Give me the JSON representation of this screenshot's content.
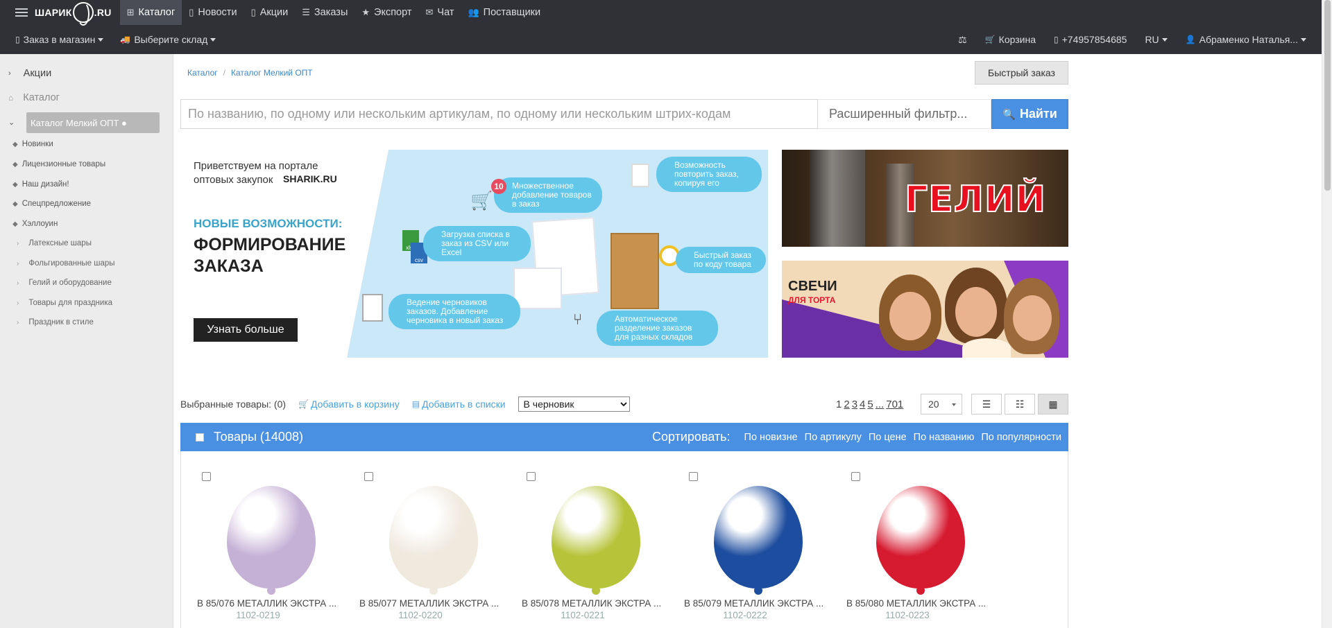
{
  "brand": {
    "logo_text_left": "ШАРИК",
    "logo_text_right": ".RU"
  },
  "nav": {
    "items": [
      {
        "label": "Каталог",
        "icon": "sitemap-icon",
        "active": true
      },
      {
        "label": "Новости",
        "icon": "document-icon"
      },
      {
        "label": "Акции",
        "icon": "document-icon"
      },
      {
        "label": "Заказы",
        "icon": "list-icon"
      },
      {
        "label": "Экспорт",
        "icon": "star-icon"
      },
      {
        "label": "Чат",
        "icon": "envelope-icon"
      },
      {
        "label": "Поставщики",
        "icon": "users-icon"
      }
    ]
  },
  "subnav": {
    "order_to_store": "Заказ в магазин",
    "choose_warehouse": "Выберите склад",
    "cart": "Корзина",
    "phone": "+74957854685",
    "lang": "RU",
    "user": "Абраменко Наталья..."
  },
  "sidebar": {
    "promo": "Акции",
    "catalog": "Каталог",
    "active": "Каталог Мелкий ОПТ ●",
    "items": [
      "Новинки",
      "Лицензионные товары",
      "Наш дизайн!",
      "Спецпредложение",
      "Хэллоуин"
    ],
    "subitems": [
      "Латексные шары",
      "Фольгированные шары",
      "Гелий и оборудование",
      "Товары для праздника",
      "Праздник в стиле"
    ]
  },
  "breadcrumb": [
    "Каталог",
    "Каталог Мелкий ОПТ"
  ],
  "fast_order": "Быстрый заказ",
  "search": {
    "placeholder": "По названию, по одному или нескольким артикулам, по одному или нескольким штрих-кодам",
    "advanced": "Расширенный фильтр...",
    "button": "Найти"
  },
  "banner_main": {
    "greeting": "Приветствуем на портале оптовых закупок",
    "logo": "SHARIK.RU",
    "new_features": "НОВЫЕ ВОЗМОЖНОСТИ:",
    "headline": "ФОРМИРОВАНИЕ ЗАКАЗА",
    "button": "Узнать больше",
    "bubbles": [
      {
        "num": "10",
        "text": "Множественное добавление товаров в заказ"
      },
      {
        "text": "Возможность повторить заказ, копируя его"
      },
      {
        "text": "Загрузка списка в заказ из CSV или Excel"
      },
      {
        "text": "Быстрый заказ по коду товара"
      },
      {
        "text": "Ведение черновиков заказов. Добавление черновика в новый заказ"
      },
      {
        "text": "Автоматическое разделение заказов для разных складов"
      }
    ],
    "file_labels": [
      "xlsx",
      "csv"
    ]
  },
  "banner_gelium": {
    "text": "ГЕЛИЙ"
  },
  "banner_candles": {
    "title": "СВЕЧИ",
    "subtitle": "ДЛЯ ТОРТА"
  },
  "toolbar": {
    "selected": "Выбранные товары: (0)",
    "add_to_cart": "Добавить в корзину",
    "add_to_lists": "Добавить в списки",
    "draft_option": "В черновик",
    "pages": [
      "1",
      "2",
      "3",
      "4",
      "5",
      "...",
      "701"
    ],
    "per_page": "20"
  },
  "goods": {
    "title": "Товары (14008)",
    "sort_label": "Сортировать:",
    "sort_options": [
      "По новизне",
      "По артикулу",
      "По цене",
      "По названию",
      "По популярности"
    ]
  },
  "products": [
    {
      "title": "В 85/076 МЕТАЛЛИК ЭКСТРА ...",
      "article": "1102-0219",
      "color": "#c6b1d6"
    },
    {
      "title": "В 85/077 МЕТАЛЛИК ЭКСТРА ...",
      "article": "1102-0220",
      "color": "#efe9de"
    },
    {
      "title": "В 85/078 МЕТАЛЛИК ЭКСТРА ...",
      "article": "1102-0221",
      "color": "#b6c43a"
    },
    {
      "title": "В 85/079 МЕТАЛЛИК ЭКСТРА ...",
      "article": "1102-0222",
      "color": "#1d4d9e"
    },
    {
      "title": "В 85/080 МЕТАЛЛИК ЭКСТРА ...",
      "article": "1102-0223",
      "color": "#d61a30"
    }
  ],
  "colors": {
    "topbar": "#2f3136",
    "accent": "#4a90e2",
    "link": "#4aa3df"
  }
}
